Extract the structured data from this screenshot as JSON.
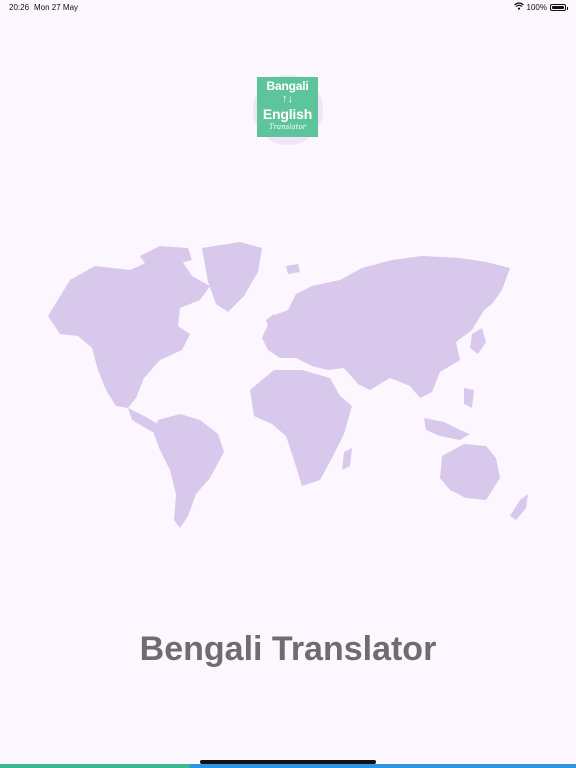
{
  "status_bar": {
    "time": "20:26",
    "date": "Mon 27 May",
    "battery_text": "100%",
    "battery_level": 1.0
  },
  "logo": {
    "line1": "Bangali",
    "line2": "English",
    "script": "Translator",
    "background_color": "#5ec49b"
  },
  "main": {
    "title": "Bengali Translator"
  },
  "colors": {
    "background": "#fcf6fe",
    "map": "#d8c8ec",
    "title": "#6f6b70",
    "progress_green": "#3bb990",
    "progress_blue": "#2f93e6"
  },
  "icons": {
    "wifi": "wifi-icon",
    "battery": "battery-icon",
    "swap": "swap-arrows-icon",
    "map": "world-map"
  }
}
